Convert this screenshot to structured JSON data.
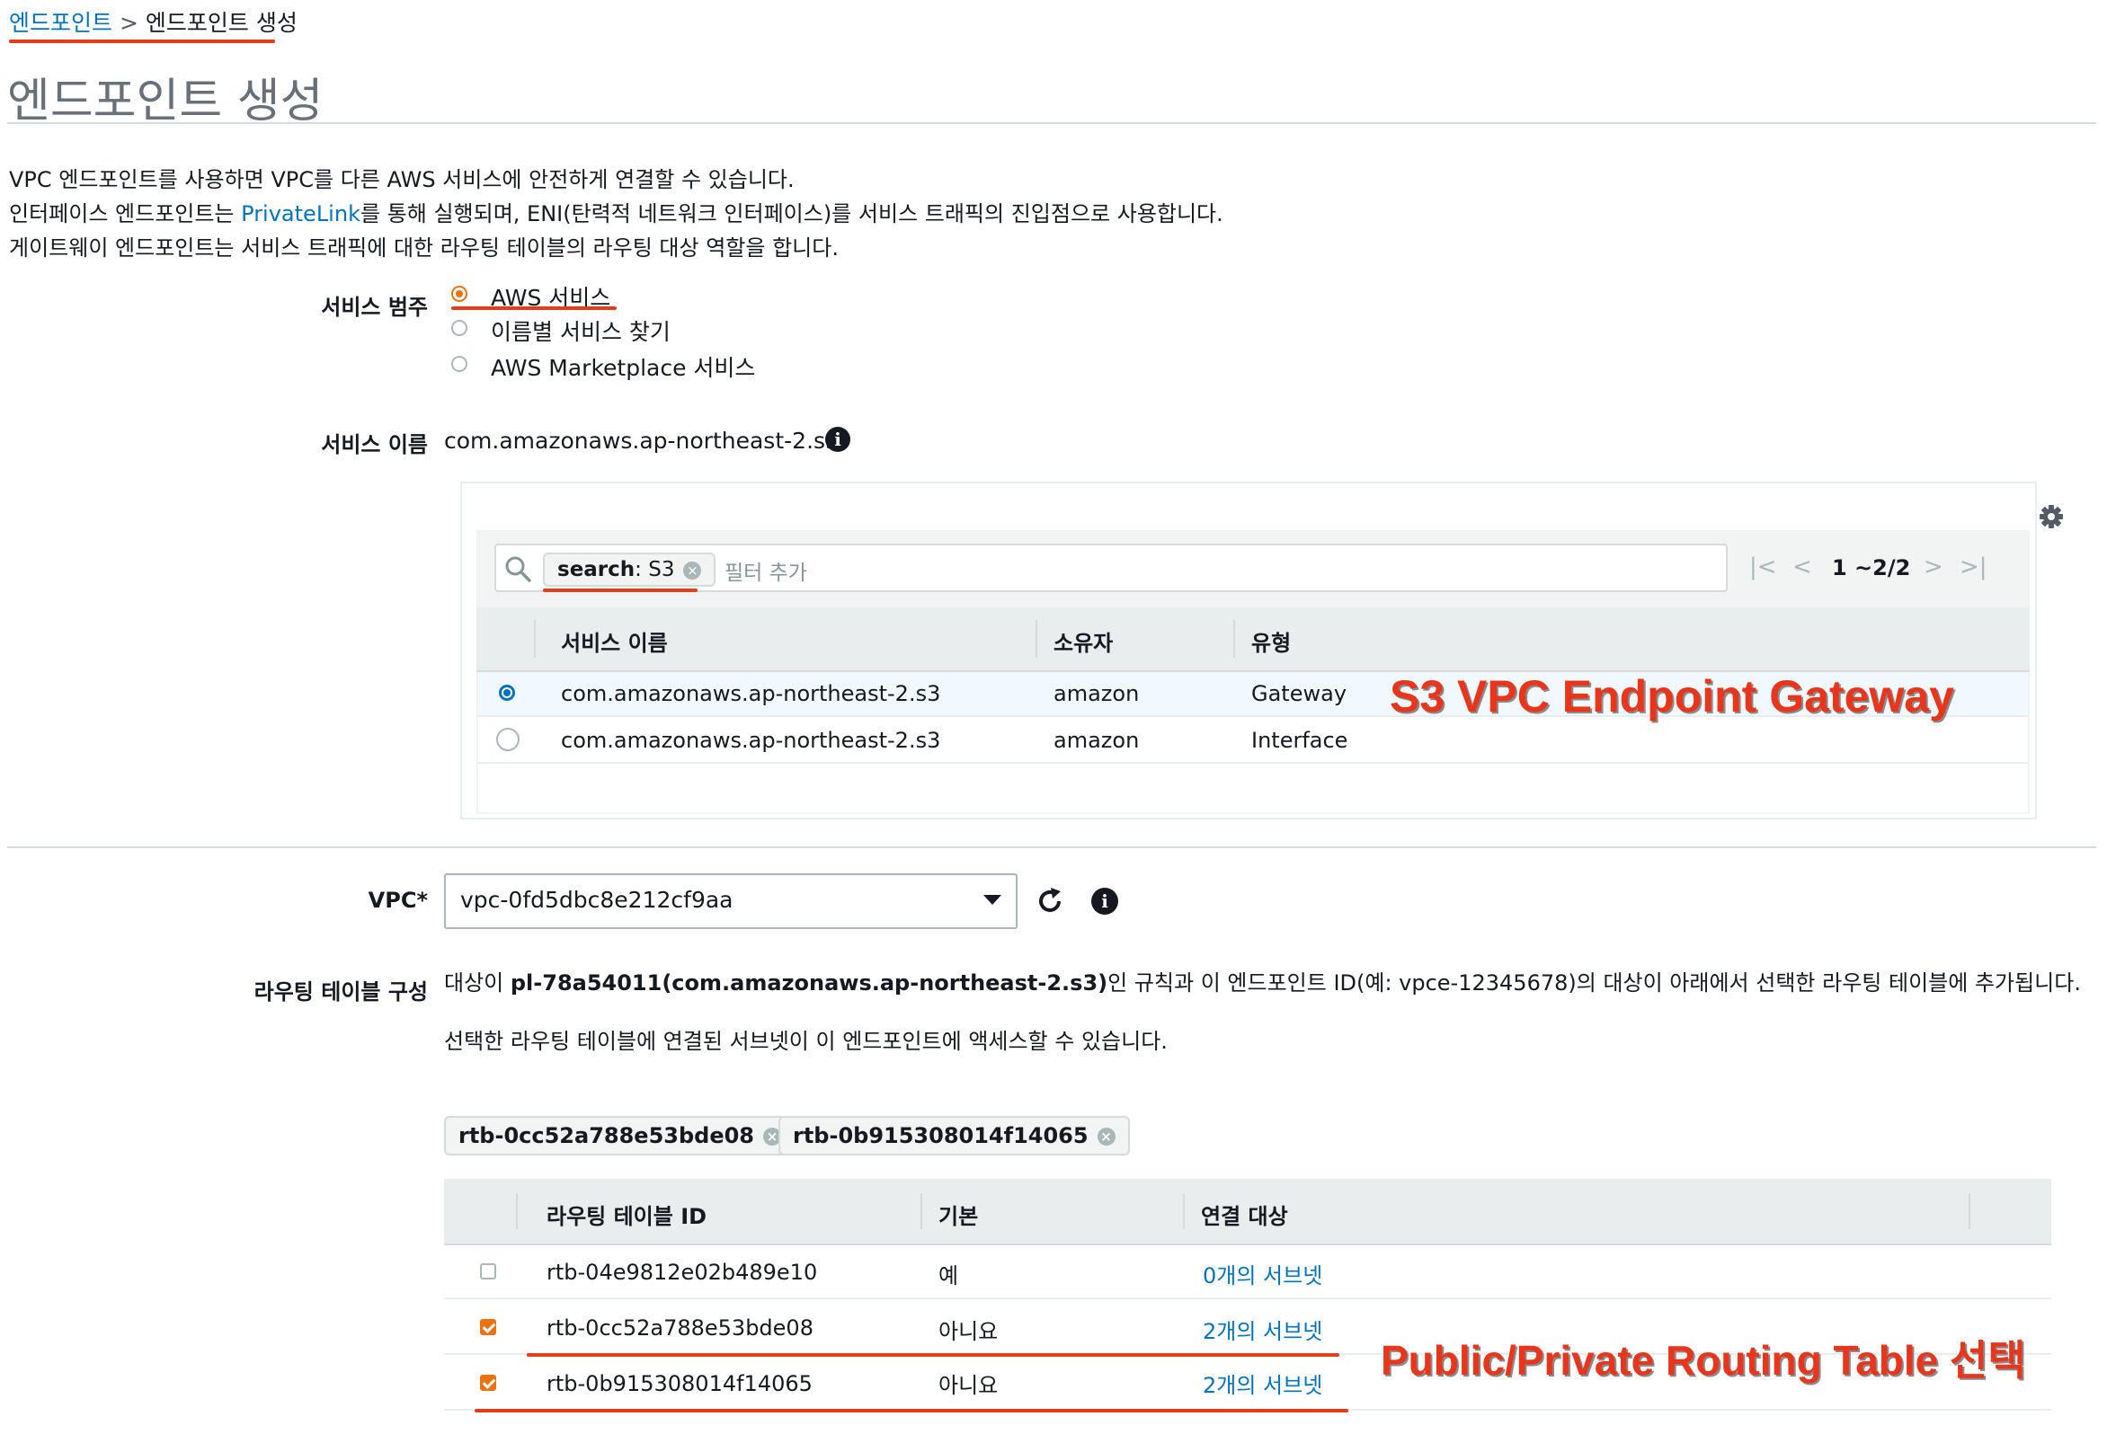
{
  "breadcrumb": {
    "link": "엔드포인트",
    "separator": ">",
    "current": "엔드포인트 생성"
  },
  "page_title": "엔드포인트 생성",
  "description": {
    "line1": "VPC 엔드포인트를 사용하면 VPC를 다른 AWS 서비스에 안전하게 연결할 수 있습니다.",
    "line2_before": "인터페이스 엔드포인트는 ",
    "line2_link": "PrivateLink",
    "line2_after": "를 통해 실행되며, ENI(탄력적 네트워크 인터페이스)를 서비스 트래픽의 진입점으로 사용합니다.",
    "line3": "게이트웨이 엔드포인트는 서비스 트래픽에 대한 라우팅 테이블의 라우팅 대상 역할을 합니다."
  },
  "service_category": {
    "label": "서비스 범주",
    "options": [
      "AWS 서비스",
      "이름별 서비스 찾기",
      "AWS Marketplace 서비스"
    ],
    "selected": "AWS 서비스"
  },
  "service_name": {
    "label": "서비스 이름",
    "value": "com.amazonaws.ap-northeast-2.s3"
  },
  "service_table": {
    "search_token_key": "search",
    "search_token_value": ": S3",
    "filter_placeholder": "필터 추가",
    "pager": {
      "range": "1 ~2/2"
    },
    "columns": [
      "서비스 이름",
      "소유자",
      "유형"
    ],
    "rows": [
      {
        "name": "com.amazonaws.ap-northeast-2.s3",
        "owner": "amazon",
        "type": "Gateway",
        "selected": true
      },
      {
        "name": "com.amazonaws.ap-northeast-2.s3",
        "owner": "amazon",
        "type": "Interface",
        "selected": false
      }
    ]
  },
  "vpc": {
    "label": "VPC*",
    "value": "vpc-0fd5dbc8e212cf9aa"
  },
  "routing": {
    "label": "라우팅 테이블 구성",
    "desc1_before": "대상이 ",
    "desc1_bold": "pl-78a54011(com.amazonaws.ap-northeast-2.s3)",
    "desc1_after": "인 규칙과 이 엔드포인트 ID(예: vpce-12345678)의 대상이 아래에서 선택한 라우팅 테이블에 추가됩니다.",
    "desc2": "선택한 라우팅 테이블에 연결된 서브넷이 이 엔드포인트에 액세스할 수 있습니다.",
    "chips": [
      "rtb-0cc52a788e53bde08",
      "rtb-0b915308014f14065"
    ],
    "columns": [
      "라우팅 테이블 ID",
      "기본",
      "연결 대상"
    ],
    "rows": [
      {
        "id": "rtb-04e9812e02b489e10",
        "main": "예",
        "assoc": "0개의 서브넷",
        "checked": false
      },
      {
        "id": "rtb-0cc52a788e53bde08",
        "main": "아니요",
        "assoc": "2개의 서브넷",
        "checked": true
      },
      {
        "id": "rtb-0b915308014f14065",
        "main": "아니요",
        "assoc": "2개의 서브넷",
        "checked": true
      }
    ]
  },
  "annotations": {
    "gateway": "S3 VPC Endpoint Gateway",
    "routing": "Public/Private Routing Table 선택"
  },
  "colors": {
    "link": "#0073bb",
    "accent": "#ec7211",
    "annotation": "#e8351c"
  },
  "icons": [
    "info-icon",
    "gear-icon",
    "search-icon",
    "refresh-icon",
    "clear-icon",
    "first-page-icon",
    "prev-page-icon",
    "next-page-icon",
    "last-page-icon",
    "dropdown-caret-icon"
  ]
}
